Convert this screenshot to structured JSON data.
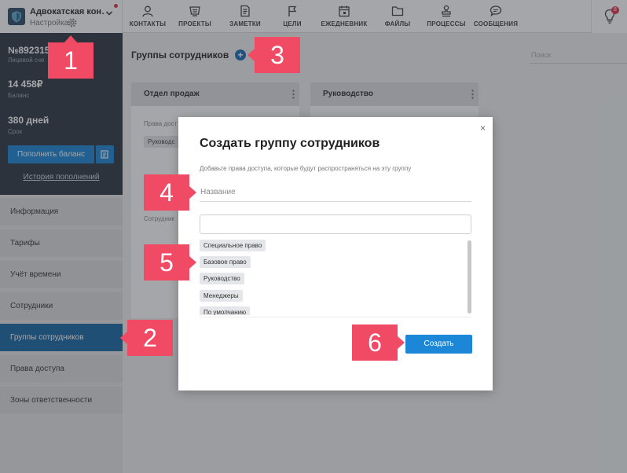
{
  "org": {
    "name": "Адвокатская кон…",
    "sub": "Настройка"
  },
  "nav": [
    {
      "label": "КОНТАКТЫ",
      "icon": "person-icon"
    },
    {
      "label": "ПРОЕКТЫ",
      "icon": "basket-icon"
    },
    {
      "label": "ЗАМЕТКИ",
      "icon": "note-icon"
    },
    {
      "label": "ЦЕЛИ",
      "icon": "flag-icon"
    },
    {
      "label": "ЕЖЕДНЕВНИК",
      "icon": "calendar-icon"
    },
    {
      "label": "ФАЙЛЫ",
      "icon": "folder-icon"
    },
    {
      "label": "ПРОЦЕССЫ",
      "icon": "stamp-icon"
    },
    {
      "label": "СООБЩЕНИЯ",
      "icon": "chat-icon"
    }
  ],
  "notifications": {
    "count": "8"
  },
  "account": {
    "number": "№892315",
    "number_label": "Лицевой сче",
    "balance": "14 458₽",
    "balance_label": "Баланс",
    "term": "380 дней",
    "term_label": "Срок",
    "topup_label": "Пополнить баланс",
    "history_label": "История пополнений"
  },
  "menu": [
    {
      "label": "Информация",
      "active": false
    },
    {
      "label": "Тарифы",
      "active": false
    },
    {
      "label": "Учёт времени",
      "active": false
    },
    {
      "label": "Сотрудники",
      "active": false
    },
    {
      "label": "Группы сотрудников",
      "active": true
    },
    {
      "label": "Права доступа",
      "active": false
    },
    {
      "label": "Зоны ответственности",
      "active": false
    }
  ],
  "main": {
    "title": "Группы сотрудников",
    "add_symbol": "+",
    "search_placeholder": "Поиск",
    "cards": [
      {
        "title": "Отдел продаж",
        "rights_label": "Права дост",
        "tag": "Руководс",
        "employees_label": "Сотрудник"
      },
      {
        "title": "Руководство"
      }
    ]
  },
  "modal": {
    "close": "×",
    "title": "Создать группу сотрудников",
    "description": "Добавьте права доступа, которые будут распространяться на эту группу",
    "name_placeholder": "Название",
    "rights": [
      "Специальное право",
      "Базовое право",
      "Руководство",
      "Менеджеры",
      "По умолчанию"
    ],
    "create_label": "Создать"
  },
  "callouts": [
    "1",
    "2",
    "3",
    "4",
    "5",
    "6"
  ]
}
